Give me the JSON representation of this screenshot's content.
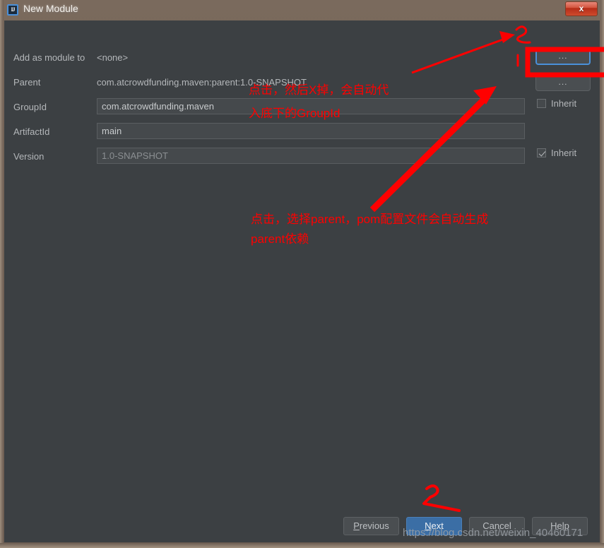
{
  "window": {
    "title": "New Module",
    "icon": "intellij-idea-icon",
    "close_label": "x"
  },
  "form": {
    "rows": [
      {
        "label": "Add as module to",
        "value": "<none>",
        "type": "static"
      },
      {
        "label": "Parent",
        "value": "com.atcrowdfunding.maven:parent:1.0-SNAPSHOT",
        "type": "static"
      },
      {
        "label": "GroupId",
        "value": "com.atcrowdfunding.maven",
        "type": "input"
      },
      {
        "label": "ArtifactId",
        "value": "main",
        "type": "input"
      },
      {
        "label": "Version",
        "value": "1.0-SNAPSHOT",
        "type": "input"
      }
    ],
    "browse_buttons": [
      {
        "label": "...",
        "focused": true
      },
      {
        "label": "...",
        "focused": false
      }
    ],
    "inherit_checkboxes": [
      {
        "label": "Inherit",
        "checked": false
      },
      {
        "label": "Inherit",
        "checked": true
      }
    ]
  },
  "footer": {
    "buttons": [
      {
        "label": "Previous",
        "mnemonic": "P",
        "primary": false
      },
      {
        "label": "Next",
        "mnemonic": "N",
        "primary": true
      },
      {
        "label": "Cancel",
        "mnemonic": "",
        "primary": false
      },
      {
        "label": "Help",
        "mnemonic": "",
        "primary": false
      }
    ]
  },
  "annotations": {
    "note_groupid_line1": "点击，然后X掉，会自动代",
    "note_groupid_line2": "入底下的GroupId",
    "note_parent_line1": "点击，选择parent，pom配置文件会自动生成",
    "note_parent_line2": "parent依赖"
  },
  "watermark": "https://blog.csdn.net/weixin_40460171",
  "colors": {
    "dialog_background": "#3c4043",
    "titlebar": "#6f6054",
    "accent_focus": "#4a90d9",
    "primary_button": "#3b6ea5",
    "annotation_red": "#ff0000",
    "close_button_red": "#d4543e"
  }
}
